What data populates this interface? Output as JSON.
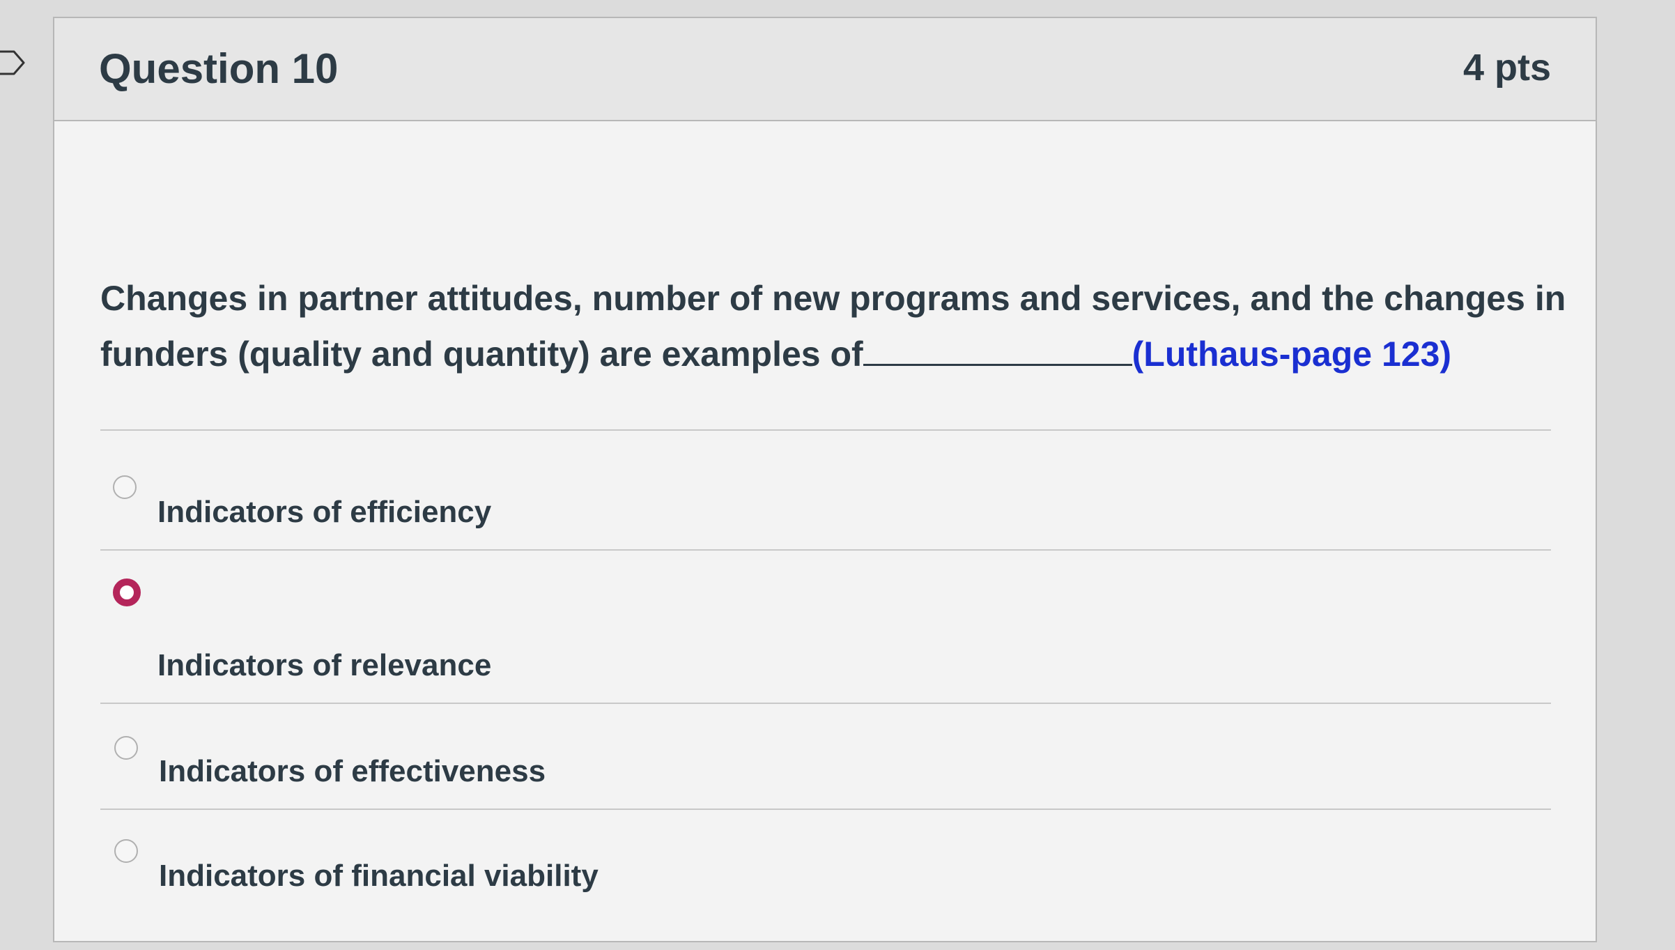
{
  "question": {
    "title": "Question 10",
    "points": "4 pts",
    "text_main": "Changes in partner attitudes, number of new programs and services, and the changes in funders (quality and quantity) are examples of",
    "reference": "(Luthaus-page 123)"
  },
  "answers": [
    {
      "label": "Indicators of efficiency",
      "selected": false
    },
    {
      "label": "Indicators of relevance",
      "selected": true
    },
    {
      "label": "Indicators of effectiveness",
      "selected": false
    },
    {
      "label": "Indicators of financial viability",
      "selected": false
    }
  ],
  "colors": {
    "selected_radio": "#b4255a",
    "reference_link": "#1a2fd1",
    "text": "#2d3b45"
  },
  "icons": {
    "bookmark": "bookmark-icon"
  }
}
